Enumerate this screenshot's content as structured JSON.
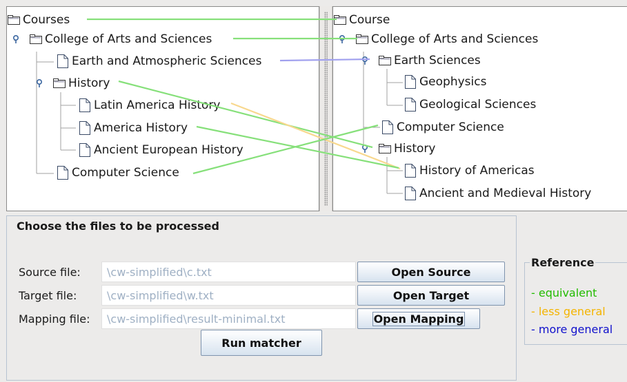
{
  "source_tree": {
    "root": "Courses",
    "college": "College of Arts and Sciences",
    "earth": "Earth and Atmospheric Sciences",
    "history": "History",
    "latin": "Latin America History",
    "america": "America History",
    "ancient": "Ancient European History",
    "cs": "Computer Science"
  },
  "target_tree": {
    "root": "Course",
    "college": "College of Arts and Sciences",
    "earth": "Earth Sciences",
    "geophysics": "Geophysics",
    "geological": "Geological Sciences",
    "cs": "Computer Science",
    "history": "History",
    "americas": "History of Americas",
    "ancient": "Ancient and Medieval History"
  },
  "files": {
    "title": "Choose the files to be processed",
    "source_label": "Source file:",
    "source_value": "\\cw-simplified\\c.txt",
    "target_label": "Target file:",
    "target_value": "\\cw-simplified\\w.txt",
    "mapping_label": "Mapping file:",
    "mapping_value": "\\cw-simplified\\result-minimal.txt",
    "open_source": "Open Source",
    "open_target": "Open Target",
    "open_mapping": "Open Mapping",
    "run": "Run matcher"
  },
  "reference": {
    "title": "Reference",
    "equivalent": "- equivalent",
    "less_general": "- less general",
    "more_general": "- more general",
    "colors": {
      "equivalent": "#22bb00",
      "less_general": "#f4b400",
      "more_general": "#1010cc",
      "mapping_equivalent": "#7fe06a",
      "mapping_less_general": "#f8d88a",
      "mapping_more_general": "#9a9ae8"
    }
  }
}
